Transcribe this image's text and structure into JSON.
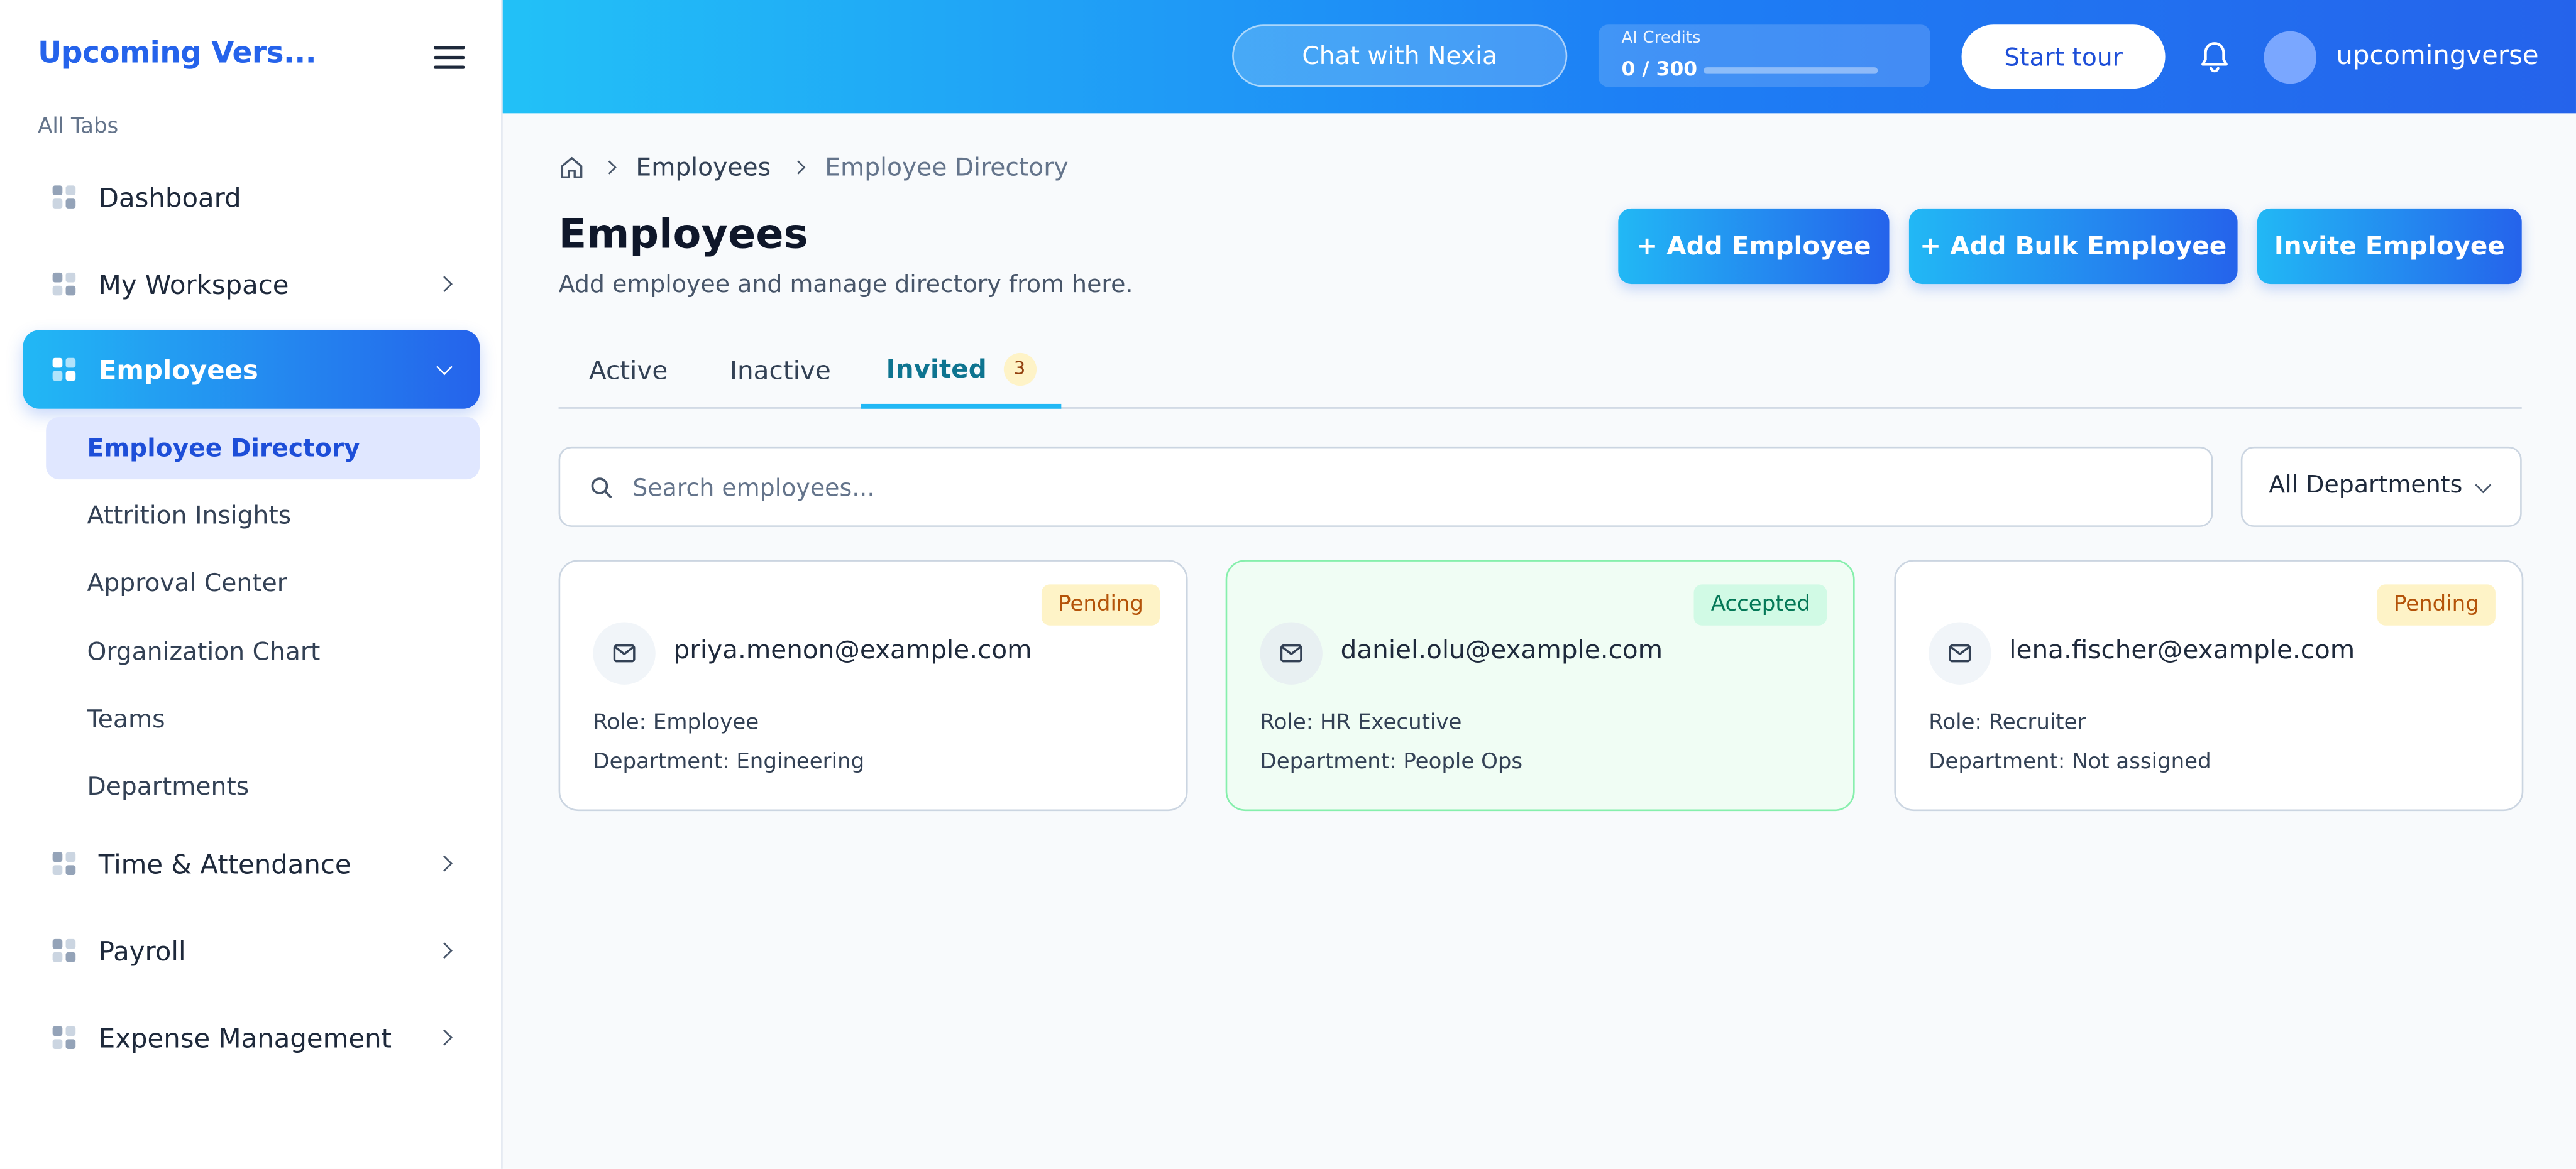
{
  "sidebar": {
    "brand": "Upcoming Vers...",
    "section_label": "All Tabs",
    "items": [
      {
        "label": "Dashboard",
        "icon": "grid-icon",
        "has_chevron": false
      },
      {
        "label": "My Workspace",
        "icon": "grid-icon",
        "has_chevron": true
      },
      {
        "label": "Employees",
        "icon": "grid-icon",
        "has_chevron": true,
        "active": true,
        "expanded": true
      },
      {
        "label": "Time & Attendance",
        "icon": "grid-icon",
        "has_chevron": true
      },
      {
        "label": "Payroll",
        "icon": "grid-icon",
        "has_chevron": true
      },
      {
        "label": "Expense Management",
        "icon": "grid-icon",
        "has_chevron": true
      }
    ],
    "sub_items": [
      {
        "label": "Employee Directory",
        "active": true
      },
      {
        "label": "Attrition Insights"
      },
      {
        "label": "Approval Center"
      },
      {
        "label": "Organization Chart"
      },
      {
        "label": "Teams"
      },
      {
        "label": "Departments"
      }
    ]
  },
  "topbar": {
    "chat_button": "Chat with Nexia",
    "credits": {
      "label": "AI Credits",
      "value": "0 / 300",
      "used_fraction": 0
    },
    "tour_button": "Start tour",
    "bell_icon": "bell-icon",
    "username": "upcomingverse"
  },
  "breadcrumb": {
    "home_icon": "home-icon",
    "items": [
      "Employees",
      "Employee Directory"
    ]
  },
  "page": {
    "title": "Employees",
    "subtitle": "Add employee and manage directory from here."
  },
  "actions": {
    "add_employee": "+ Add Employee",
    "add_bulk": "+ Add Bulk Employee",
    "invite": "Invite Employee"
  },
  "tabs": {
    "active": "Active",
    "inactive": "Inactive",
    "invited": "Invited",
    "invited_count": "3"
  },
  "search": {
    "placeholder": "Search employees..."
  },
  "department_filter": {
    "selected": "All Departments"
  },
  "invites": [
    {
      "email": "priya.menon@example.com",
      "status": "Pending",
      "role": "Role: Employee",
      "department": "Department: Engineering"
    },
    {
      "email": "daniel.olu@example.com",
      "status": "Accepted",
      "role": "Role: HR Executive",
      "department": "Department: People Ops"
    },
    {
      "email": "lena.fischer@example.com",
      "status": "Pending",
      "role": "Role: Recruiter",
      "department": "Department: Not assigned"
    }
  ],
  "colors": {
    "brand": "#2563eb",
    "accent_start": "#22b8f5",
    "accent_end": "#2563eb",
    "pending_bg": "#fef3c7",
    "accepted_bg": "#d1fae5"
  }
}
